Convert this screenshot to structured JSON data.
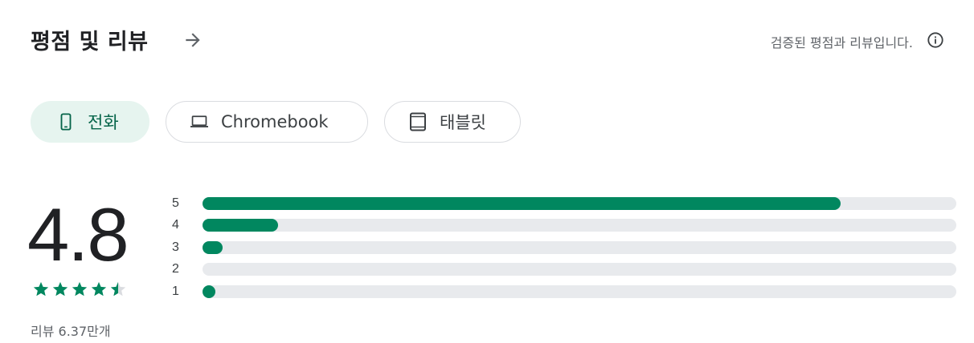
{
  "header": {
    "title": "평점 및 리뷰",
    "verified_text": "검증된 평점과 리뷰입니다."
  },
  "device_tabs": [
    {
      "label": "전화",
      "icon": "phone-icon",
      "selected": true
    },
    {
      "label": "Chromebook",
      "icon": "laptop-icon",
      "selected": false
    },
    {
      "label": "태블릿",
      "icon": "tablet-icon",
      "selected": false
    }
  ],
  "rating": {
    "score": "4.8",
    "stars_value": 4.5,
    "review_count": "리뷰 6.37만개"
  },
  "distribution": [
    {
      "label": "5",
      "fraction": 0.846
    },
    {
      "label": "4",
      "fraction": 0.1
    },
    {
      "label": "3",
      "fraction": 0.027
    },
    {
      "label": "2",
      "fraction": 0.0
    },
    {
      "label": "1",
      "fraction": 0.017
    }
  ],
  "colors": {
    "accent": "#01875f",
    "track": "#e8eaed",
    "chip_active_bg": "#e6f4ef",
    "chip_active_text": "#056449"
  }
}
